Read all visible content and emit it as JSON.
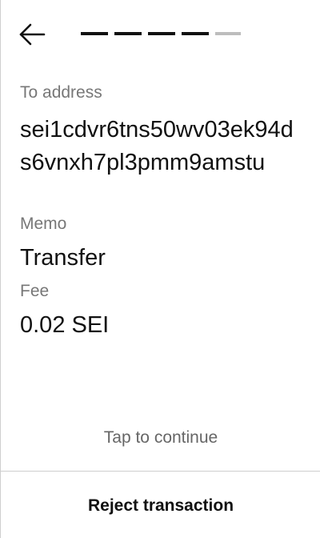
{
  "header": {
    "back_icon": "arrow-left-icon",
    "progress": {
      "total_steps": 5,
      "current_step": 4
    }
  },
  "details": {
    "to_address_label": "To address",
    "to_address_value": "sei1cdvr6tns50wv03ek94ds6vnxh7pl3pmm9amstu",
    "memo_label": "Memo",
    "memo_value": "Transfer",
    "fee_label": "Fee",
    "fee_value": "0.02 SEI"
  },
  "footer": {
    "tap_hint": "Tap to continue",
    "reject_label": "Reject transaction"
  },
  "colors": {
    "text_primary": "#111111",
    "text_secondary": "#777777",
    "progress_active": "#111111",
    "progress_inactive": "#bdbdbd",
    "divider": "#cfcfcf"
  }
}
